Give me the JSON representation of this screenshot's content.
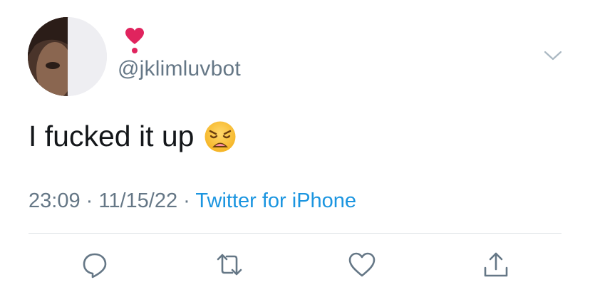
{
  "user": {
    "display_name_emoji": "❣️",
    "handle": "@jklimluvbot"
  },
  "tweet": {
    "text": "I fucked it up",
    "emoji": "weary-face"
  },
  "meta": {
    "time": "23:09",
    "separator": "·",
    "date": "11/15/22",
    "source": "Twitter for iPhone"
  },
  "actions": [
    "reply-icon",
    "retweet-icon",
    "like-icon",
    "share-icon"
  ],
  "colors": {
    "secondary_text": "#657786",
    "link": "#1b95e0",
    "primary_text": "#14171a",
    "heart_red": "#e0245e"
  }
}
